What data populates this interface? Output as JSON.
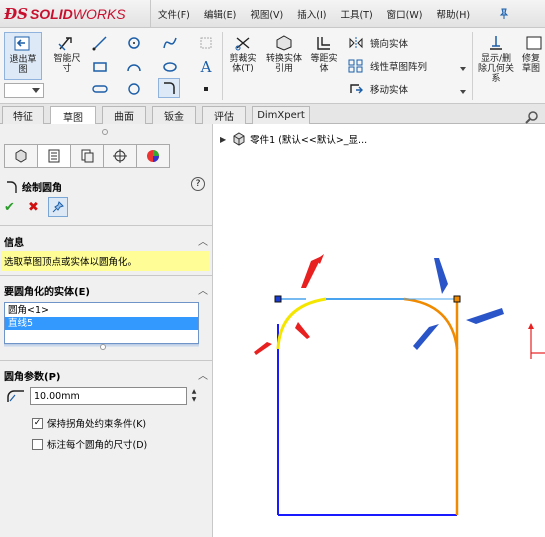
{
  "app": {
    "logo_ds": "𝓓S",
    "logo_solid": "SOLID",
    "logo_works": "WORKS"
  },
  "menu": [
    "文件(F)",
    "编辑(E)",
    "视图(V)",
    "插入(I)",
    "工具(T)",
    "窗口(W)",
    "帮助(H)"
  ],
  "ribbon": {
    "exit_sketch": "退出草图",
    "smart_dim": "智能尺寸",
    "trim": "剪裁实体(T)",
    "convert": "转换实体引用",
    "offset": "等距实体",
    "mirror": "镜向实体",
    "linear_pattern": "线性草图阵列",
    "move": "移动实体",
    "show_relations": "显示/删除几何关系",
    "repair": "修复草图"
  },
  "tabs": [
    "特征",
    "草图",
    "曲面",
    "钣金",
    "评估",
    "DimXpert"
  ],
  "active_tab": "草图",
  "tree": {
    "part": "零件1 (默认<<默认>_显..."
  },
  "panel": {
    "title": "绘制圆角",
    "help": "?",
    "ok": "✔",
    "cancel": "✖",
    "info_header": "信息",
    "info_message": "选取草图顶点或实体以圆角化。",
    "entities_header": "要圆角化的实体(E)",
    "entities": [
      "圆角<1>",
      "直线5"
    ],
    "selected_entity": "直线5",
    "params_header": "圆角参数(P)",
    "radius": "10.00mm",
    "keep_constraint": "保持拐角处约束条件(K)",
    "keep_constraint_checked": true,
    "dimension_each": "标注每个圆角的尺寸(D)",
    "dimension_each_checked": false
  },
  "colors": {
    "accent": "#1c5ea8",
    "info_bg": "#fefd96",
    "selection": "#3399ff",
    "sketch_line": "#1a1aff",
    "fillet_yellow": "#f5e600",
    "fillet_orange": "#f08a00",
    "arrow_red": "#e82020",
    "arrow_blue": "#2a55c8"
  }
}
